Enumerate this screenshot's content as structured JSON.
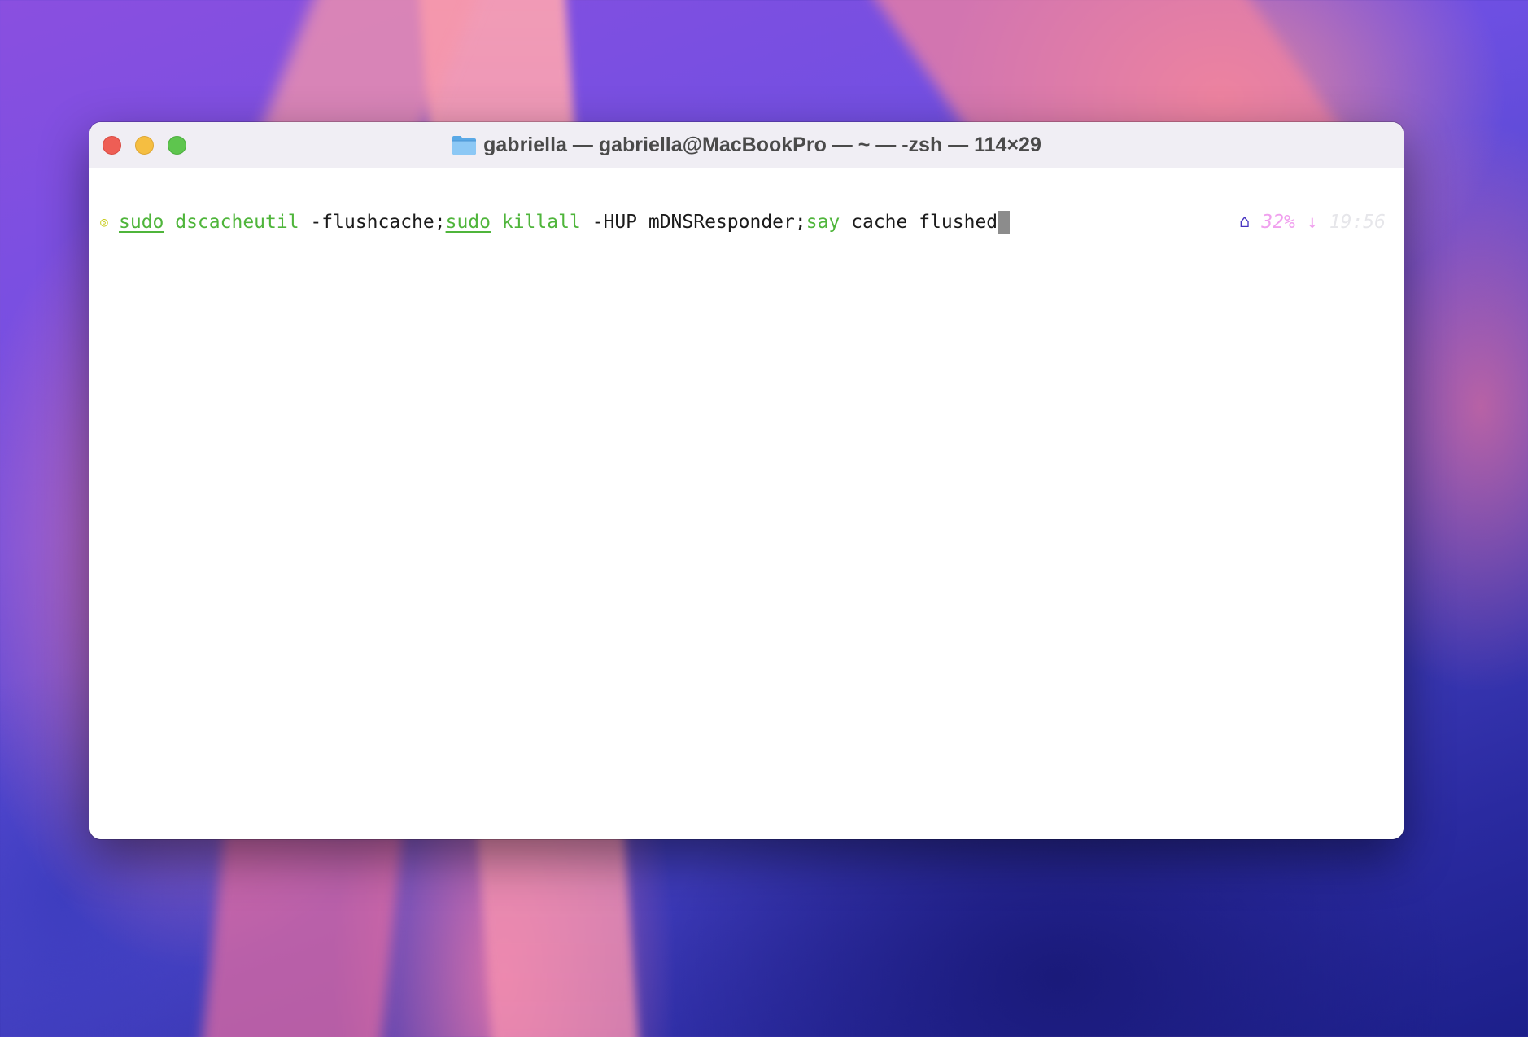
{
  "window": {
    "title": "gabriella — gabriella@MacBookPro — ~ — -zsh — 114×29"
  },
  "terminal": {
    "prompt_symbol": "◎",
    "command": [
      {
        "text": "sudo",
        "style": "sudo"
      },
      {
        "text": " ",
        "style": "plain"
      },
      {
        "text": "dscacheutil",
        "style": "cmd"
      },
      {
        "text": " -flushcache;",
        "style": "plain"
      },
      {
        "text": "sudo",
        "style": "sudo"
      },
      {
        "text": " ",
        "style": "plain"
      },
      {
        "text": "killall",
        "style": "cmd"
      },
      {
        "text": " -HUP mDNSResponder;",
        "style": "plain"
      },
      {
        "text": "say",
        "style": "cmd"
      },
      {
        "text": " cache flushed",
        "style": "plain"
      }
    ],
    "right_prompt": {
      "home_icon": "⌂",
      "battery": "32%",
      "arrow_icon": "↓",
      "time": "19:56"
    }
  },
  "colors": {
    "command_green": "#4fb53b",
    "prompt_yellow": "#c8cc1e",
    "battery_pink": "#f0a0ee",
    "home_purple": "#4532c0"
  }
}
